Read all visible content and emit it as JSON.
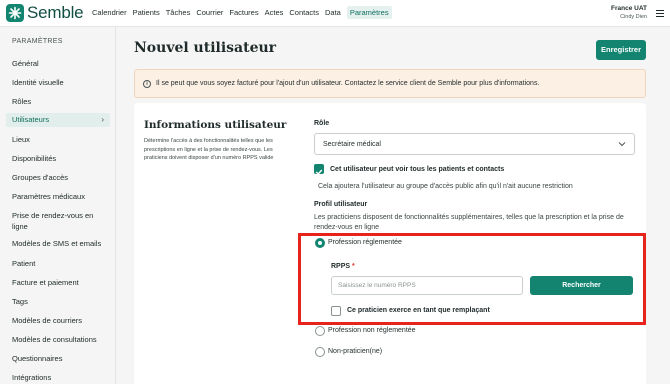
{
  "header": {
    "brand": "Semble",
    "nav": [
      "Calendrier",
      "Patients",
      "Tâches",
      "Courrier",
      "Factures",
      "Actes",
      "Contacts",
      "Data",
      "Paramètres"
    ],
    "active_nav": "Paramètres",
    "user_org": "France UAT",
    "user_name": "Cindy Dien"
  },
  "sidebar": {
    "title": "PARAMÈTRES",
    "items": [
      {
        "label": "Général"
      },
      {
        "label": "Identité visuelle"
      },
      {
        "label": "Rôles"
      },
      {
        "label": "Utilisateurs",
        "active": true
      },
      {
        "label": "Lieux"
      },
      {
        "label": "Disponibilités"
      },
      {
        "label": "Groupes d'accès"
      },
      {
        "label": "Paramètres médicaux"
      },
      {
        "label": "Prise de rendez-vous en ligne"
      },
      {
        "label": "Modèles de SMS et emails"
      },
      {
        "label": "Patient"
      },
      {
        "label": "Facture et paiement"
      },
      {
        "label": "Tags"
      },
      {
        "label": "Modèles de courriers"
      },
      {
        "label": "Modèles de consultations"
      },
      {
        "label": "Questionnaires"
      },
      {
        "label": "Intégrations"
      }
    ]
  },
  "main": {
    "title": "Nouvel utilisateur",
    "save_label": "Enregistrer",
    "alert": "Il se peut que vous soyez facturé pour l'ajout d'un utilisateur. Contactez le service client de Semble pour plus d'informations.",
    "section": {
      "title": "Informations utilisateur",
      "description": "Détermine l'accès à des fonctionnalités telles que les prescriptions en ligne et la prise de rendez-vous. Les praticiens doivent disposer d'un numéro RPPS valide"
    },
    "role": {
      "label": "Rôle",
      "value": "Secrétaire médical"
    },
    "see_all_patients": {
      "label": "Cet utilisateur peut voir tous les patients et contacts",
      "checked": true,
      "help": "Cela ajoutera l'utilisateur au groupe d'accès public afin qu'il n'ait aucune restriction"
    },
    "profile": {
      "label": "Profil utilisateur",
      "help": "Les practiciens disposent de fonctionnalités supplémentaires, telles que la prescription et la prise de rendez-vous en ligne",
      "options": [
        {
          "label": "Profession réglementée",
          "selected": true
        },
        {
          "label": "Profession non réglementée",
          "selected": false
        },
        {
          "label": "Non-praticien(ne)",
          "selected": false
        }
      ]
    },
    "rpps": {
      "label": "RPPS",
      "required_mark": "*",
      "placeholder": "Saisissez le numéro RPPS",
      "search_label": "Rechercher",
      "substitute_label": "Ce praticien exerce en tant que remplaçant",
      "substitute_checked": false
    }
  },
  "colors": {
    "accent": "#12846f",
    "highlight": "#e8231c",
    "alert_bg": "#fcefe3"
  }
}
